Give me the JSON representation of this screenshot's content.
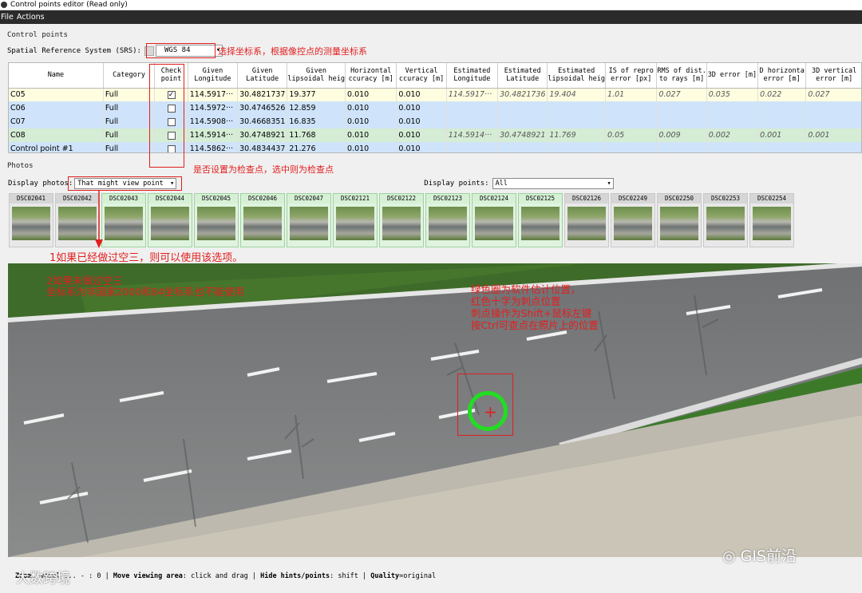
{
  "window": {
    "title": "Control points editor (Read only)"
  },
  "menu": [
    "File",
    "Actions"
  ],
  "control_points_section": "Control points",
  "srs": {
    "label": "Spatial Reference System (SRS):",
    "value": "WGS 84"
  },
  "annotations": {
    "srs_note": "选择坐标系，根据像控点的测量坐标系",
    "check_note": "是否设置为检查点，选中则为检查点",
    "photos_note": "1如果已经做过空三，则可以使用该选项。",
    "viewer_note_line1": "2如果未做过空三",
    "viewer_note_line2": "坐标系为非国家2000和84坐标系也不能使用",
    "marker_note_line1": "绿色圈为软件估计位置，",
    "marker_note_line2": "红色十字为刺点位置",
    "marker_note_line3": "刺点操作为Shift+鼠标左键",
    "marker_note_line4": "按Ctrl可查点在照片上的位置"
  },
  "table": {
    "headers": [
      [
        "Name",
        ""
      ],
      [
        "Category",
        ""
      ],
      [
        "Check",
        "point"
      ],
      [
        "Given",
        "Longitude"
      ],
      [
        "Given",
        "Latitude"
      ],
      [
        "Given",
        "lipsoidal heig"
      ],
      [
        "Horizontal",
        "ccuracy [m]"
      ],
      [
        "Vertical",
        "ccuracy [m]"
      ],
      [
        "Estimated",
        "Longitude"
      ],
      [
        "Estimated",
        "Latitude"
      ],
      [
        "Estimated",
        "lipsoidal heig"
      ],
      [
        "IS of repro",
        "error [px]"
      ],
      [
        "RMS of dist.",
        "to rays [m]"
      ],
      [
        "3D error [m]",
        ""
      ],
      [
        "D horizonta",
        "error [m]"
      ],
      [
        "3D vertical",
        "error [m]"
      ]
    ],
    "rows": [
      {
        "name": "C05",
        "category": "Full",
        "check": true,
        "lon": "114.5917···",
        "lat": "30.4821737",
        "h": "19.377",
        "hacc": "0.010",
        "vacc": "0.010",
        "elon": "114.5917···",
        "elat": "30.4821736",
        "eh": "19.404",
        "rep": "1.01",
        "rms": "0.027",
        "e3d": "0.035",
        "eh2": "0.022",
        "ev": "0.027"
      },
      {
        "name": "C06",
        "category": "Full",
        "check": false,
        "lon": "114.5972···",
        "lat": "30.4746526",
        "h": "12.859",
        "hacc": "0.010",
        "vacc": "0.010",
        "elon": "",
        "elat": "",
        "eh": "",
        "rep": "",
        "rms": "",
        "e3d": "",
        "eh2": "",
        "ev": ""
      },
      {
        "name": "C07",
        "category": "Full",
        "check": false,
        "lon": "114.5908···",
        "lat": "30.4668351",
        "h": "16.835",
        "hacc": "0.010",
        "vacc": "0.010",
        "elon": "",
        "elat": "",
        "eh": "",
        "rep": "",
        "rms": "",
        "e3d": "",
        "eh2": "",
        "ev": ""
      },
      {
        "name": "C08",
        "category": "Full",
        "check": false,
        "lon": "114.5914···",
        "lat": "30.4748921",
        "h": "11.768",
        "hacc": "0.010",
        "vacc": "0.010",
        "elon": "114.5914···",
        "elat": "30.4748921",
        "eh": "11.769",
        "rep": "0.05",
        "rms": "0.009",
        "e3d": "0.002",
        "eh2": "0.001",
        "ev": "0.001"
      },
      {
        "name": "Control point #1",
        "category": "Full",
        "check": false,
        "lon": "114.5862···",
        "lat": "30.4834437",
        "h": "21.276",
        "hacc": "0.010",
        "vacc": "0.010",
        "elon": "",
        "elat": "",
        "eh": "",
        "rep": "",
        "rms": "",
        "e3d": "",
        "eh2": "",
        "ev": ""
      }
    ]
  },
  "photos_section": "Photos",
  "display_photos": {
    "label": "Display photos:",
    "value": "That might view point"
  },
  "display_points": {
    "label": "Display points:",
    "value": "All"
  },
  "thumbnails": [
    "DSC02041",
    "DSC02042",
    "DSC02043",
    "DSC02044",
    "DSC02045",
    "DSC02046",
    "DSC02047",
    "DSC02121",
    "DSC02122",
    "DSC02123",
    "DSC02124",
    "DSC02125",
    "DSC02126",
    "DSC02249",
    "DSC02250",
    "DSC02253",
    "DSC02254"
  ],
  "status": {
    "zoom_label": "Zoom",
    "zoom_text": ": wheel ... - : 0",
    "move_label": "Move viewing area",
    "move_text": ": click and drag",
    "hide_label": "Hide hints/points",
    "hide_text": ": shift",
    "quality_label": "Quality",
    "quality_text": "=original"
  },
  "watermarks": {
    "left": "大数跨境",
    "right": "GIS前沿"
  },
  "colors": {
    "annotation_red": "#e21f1f",
    "estimate_circle": "#22dd22",
    "menu_bg": "#2b2b2b"
  }
}
